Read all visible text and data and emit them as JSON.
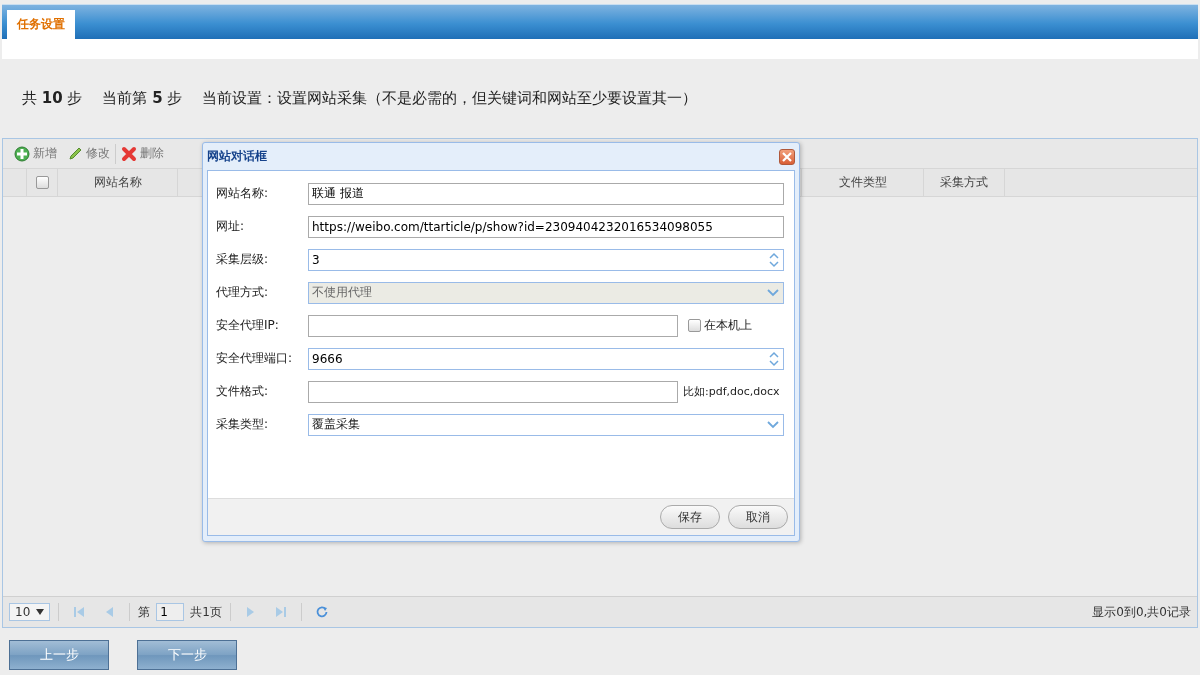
{
  "tabs": [
    {
      "label": "任务设置",
      "selected": true
    }
  ],
  "step_info": [
    "共 **10** 步",
    "当前第 **5** 步",
    "当前设置：设置网站采集（不是必需的，但关键词和网站至少要设置其一）"
  ],
  "toolbar": [
    {
      "kind": "add",
      "label": "新增"
    },
    {
      "kind": "edit",
      "label": "修改"
    },
    {
      "kind": "delete",
      "label": "删除"
    }
  ],
  "table": {
    "select_all_checked": false,
    "columns": [
      {
        "label": "网站名称",
        "kind": "name"
      },
      {
        "label": "文件类型",
        "kind": "type"
      },
      {
        "label": "采集方式",
        "kind": "mode"
      }
    ]
  },
  "pager": {
    "page_size": "10",
    "page_label": "第",
    "page": "1",
    "total_pages": "共1页",
    "summary": "显示0到0,共0记录"
  },
  "dialog": {
    "title": "网站对话框",
    "fields": [
      {
        "kind": "text",
        "label": "网站名称:",
        "value": "联通 报道"
      },
      {
        "kind": "text",
        "label": "网址:",
        "value": "https://weibo.com/ttarticle/p/show?id=2309404232016534098055"
      },
      {
        "kind": "spinner",
        "label": "采集层级:",
        "value": "3"
      },
      {
        "kind": "select",
        "label": "代理方式:",
        "value": "不使用代理",
        "disabled": true
      },
      {
        "kind": "text-check",
        "label": "安全代理IP:",
        "check_label": "在本机上",
        "checked": false
      },
      {
        "kind": "spinner",
        "label": "安全代理端口:",
        "value": "9666"
      },
      {
        "kind": "text-hint",
        "label": "文件格式:",
        "hint": "比如:pdf,doc,docx"
      },
      {
        "kind": "select",
        "label": "采集类型:",
        "value": "覆盖采集",
        "disabled": false
      }
    ],
    "buttons": [
      "保存",
      "取消"
    ]
  },
  "nav_buttons": [
    "上一步",
    "下一步"
  ]
}
